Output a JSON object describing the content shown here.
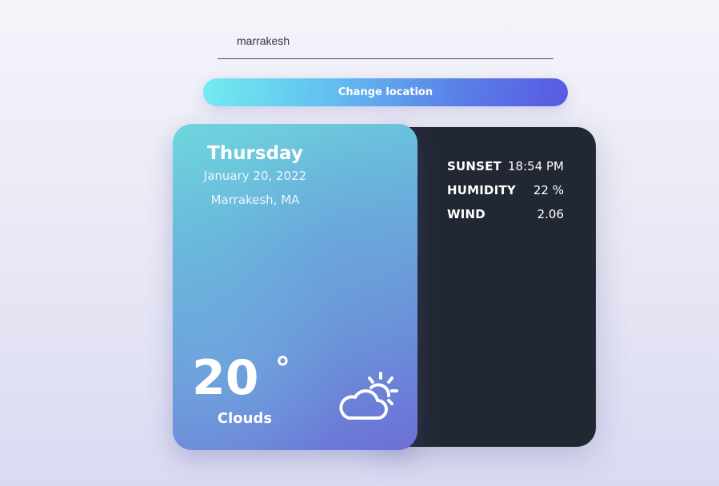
{
  "search": {
    "value": "marrakesh",
    "placeholder": ""
  },
  "button": {
    "label": "Change location"
  },
  "weather": {
    "day": "Thursday",
    "date": "January 20, 2022",
    "location": "Marrakesh, MA",
    "temperature": "20",
    "degree_symbol": "°",
    "condition": "Clouds",
    "icon": "sun-behind-cloud-icon"
  },
  "details": [
    {
      "label": "SUNSET",
      "value": "18:54 PM"
    },
    {
      "label": "HUMIDITY",
      "value": "22 %"
    },
    {
      "label": "WIND",
      "value": "2.06"
    }
  ],
  "colors": {
    "info_panel": "#222833",
    "button_gradient_start": "#72ecf0",
    "button_gradient_end": "#5a58e2",
    "card_gradient_start": "#6fd6dd",
    "card_gradient_end": "#6c6fd6"
  }
}
